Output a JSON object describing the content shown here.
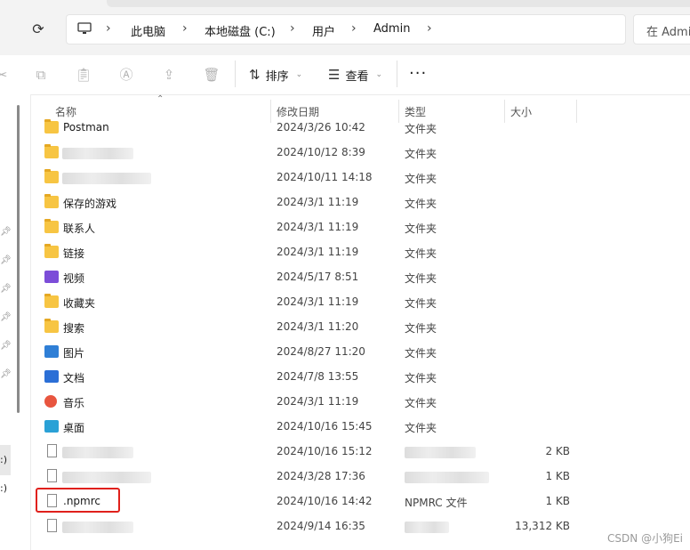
{
  "address_bar": {
    "refresh_icon": "refresh-icon",
    "breadcrumb": [
      "此电脑",
      "本地磁盘 (C:)",
      "用户",
      "Admin"
    ],
    "search_placeholder": "在 Admi"
  },
  "toolbar": {
    "sort_label": "排序",
    "view_label": "查看",
    "more_label": "···",
    "icons": [
      "cut-icon",
      "copy-icon",
      "paste-icon",
      "rename-icon",
      "share-icon",
      "delete-icon"
    ]
  },
  "sidebar": {
    "drive_labels": [
      ":)",
      ":)"
    ]
  },
  "columns": {
    "name": "名称",
    "modified": "修改日期",
    "type": "类型",
    "size": "大小"
  },
  "files": [
    {
      "name": "Postman",
      "modified": "2024/3/26 10:42",
      "type": "文件夹",
      "size": "",
      "icon": "folder"
    },
    {
      "name": "",
      "modified": "2024/10/12 8:39",
      "type": "文件夹",
      "size": "",
      "icon": "folder",
      "obscured": true
    },
    {
      "name": "",
      "modified": "2024/10/11 14:18",
      "type": "文件夹",
      "size": "",
      "icon": "folder",
      "obscured": true
    },
    {
      "name": "保存的游戏",
      "modified": "2024/3/1 11:19",
      "type": "文件夹",
      "size": "",
      "icon": "folder"
    },
    {
      "name": "联系人",
      "modified": "2024/3/1 11:19",
      "type": "文件夹",
      "size": "",
      "icon": "folder"
    },
    {
      "name": "链接",
      "modified": "2024/3/1 11:19",
      "type": "文件夹",
      "size": "",
      "icon": "folder"
    },
    {
      "name": "视频",
      "modified": "2024/5/17 8:51",
      "type": "文件夹",
      "size": "",
      "icon": "video"
    },
    {
      "name": "收藏夹",
      "modified": "2024/3/1 11:19",
      "type": "文件夹",
      "size": "",
      "icon": "folder"
    },
    {
      "name": "搜索",
      "modified": "2024/3/1 11:20",
      "type": "文件夹",
      "size": "",
      "icon": "folder"
    },
    {
      "name": "图片",
      "modified": "2024/8/27 11:20",
      "type": "文件夹",
      "size": "",
      "icon": "pictures"
    },
    {
      "name": "文档",
      "modified": "2024/7/8 13:55",
      "type": "文件夹",
      "size": "",
      "icon": "documents"
    },
    {
      "name": "音乐",
      "modified": "2024/3/1 11:19",
      "type": "文件夹",
      "size": "",
      "icon": "music"
    },
    {
      "name": "桌面",
      "modified": "2024/10/16 15:45",
      "type": "文件夹",
      "size": "",
      "icon": "desktop"
    },
    {
      "name": "",
      "modified": "2024/10/16 15:12",
      "type": "",
      "size": "2 KB",
      "icon": "file",
      "obscured": true
    },
    {
      "name": "",
      "modified": "2024/3/28 17:36",
      "type": "",
      "size": "1 KB",
      "icon": "file",
      "obscured": true
    },
    {
      "name": ".npmrc",
      "modified": "2024/10/16 14:42",
      "type": "NPMRC 文件",
      "size": "1 KB",
      "icon": "file",
      "highlighted": true
    },
    {
      "name": "",
      "modified": "2024/9/14 16:35",
      "type": "",
      "size": "13,312 KB",
      "icon": "file",
      "obscured": true
    }
  ],
  "watermark": "CSDN @小狗Ei",
  "colors": {
    "folder": "#f7c543",
    "highlight_border": "#e0201b"
  }
}
